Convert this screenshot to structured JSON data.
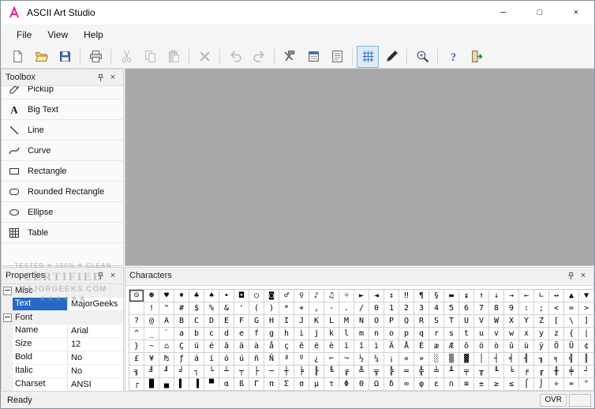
{
  "window": {
    "title": "ASCII Art Studio",
    "controls": {
      "minimize": "─",
      "maximize": "□",
      "close": "×"
    }
  },
  "menu": {
    "items": [
      "File",
      "View",
      "Help"
    ]
  },
  "toolbar": {
    "buttons": [
      {
        "name": "new-button",
        "icon": "new-document-icon"
      },
      {
        "name": "open-button",
        "icon": "open-folder-icon"
      },
      {
        "name": "save-button",
        "icon": "save-icon"
      },
      {
        "separator": true
      },
      {
        "name": "print-button",
        "icon": "print-icon"
      },
      {
        "separator": true
      },
      {
        "name": "cut-button",
        "icon": "cut-icon",
        "disabled": true
      },
      {
        "name": "copy-button",
        "icon": "copy-icon",
        "disabled": true
      },
      {
        "name": "paste-button",
        "icon": "paste-icon",
        "disabled": true
      },
      {
        "separator": true
      },
      {
        "name": "delete-button",
        "icon": "delete-icon",
        "disabled": true
      },
      {
        "separator": true
      },
      {
        "name": "undo-button",
        "icon": "undo-icon",
        "disabled": true
      },
      {
        "name": "redo-button",
        "icon": "redo-icon",
        "disabled": true
      },
      {
        "separator": true
      },
      {
        "name": "tools-button",
        "icon": "tools-icon"
      },
      {
        "name": "properties-button",
        "icon": "property-sheet-icon"
      },
      {
        "name": "text-document-button",
        "icon": "text-document-icon"
      },
      {
        "separator": true
      },
      {
        "name": "grid-toggle-button",
        "icon": "grid-icon",
        "pressed": true
      },
      {
        "name": "pen-button",
        "icon": "pen-icon"
      },
      {
        "separator": true
      },
      {
        "name": "zoom-button",
        "icon": "zoom-icon"
      },
      {
        "separator": true
      },
      {
        "name": "help-button",
        "icon": "help-icon"
      },
      {
        "name": "exit-button",
        "icon": "exit-icon"
      }
    ]
  },
  "toolbox": {
    "title": "Toolbox",
    "items": [
      {
        "label": "Pickup",
        "icon": "pickup-icon"
      },
      {
        "label": "Big Text",
        "icon": "big-text-icon"
      },
      {
        "label": "Line",
        "icon": "line-icon"
      },
      {
        "label": "Curve",
        "icon": "curve-icon"
      },
      {
        "label": "Rectangle",
        "icon": "rectangle-icon"
      },
      {
        "label": "Rounded Rectangle",
        "icon": "rounded-rectangle-icon"
      },
      {
        "label": "Ellipse",
        "icon": "ellipse-icon"
      },
      {
        "label": "Table",
        "icon": "table-icon"
      }
    ]
  },
  "watermark": {
    "line1": "TESTED ✶ 100% ✶ CLEAN",
    "line2": "CERTIFIED",
    "line3": "MAJORGEEKS.COM",
    "line4": "★★★★★★"
  },
  "properties": {
    "title": "Properties",
    "groups": [
      {
        "label": "Misc",
        "rows": [
          {
            "name": "Text",
            "value": "MajorGeeks",
            "selected": true
          }
        ]
      },
      {
        "label": "Font",
        "rows": [
          {
            "name": "Name",
            "value": "Arial"
          },
          {
            "name": "Size",
            "value": "12"
          },
          {
            "name": "Bold",
            "value": "No"
          },
          {
            "name": "Italic",
            "value": "No"
          },
          {
            "name": "Charset",
            "value": "ANSI"
          }
        ]
      }
    ]
  },
  "characters": {
    "title": "Characters",
    "selected": {
      "row": 0,
      "col": 0
    },
    "rows": [
      [
        "☺",
        "☻",
        "♥",
        "♦",
        "♣",
        "♠",
        "•",
        "◘",
        "○",
        "◙",
        "♂",
        "♀",
        "♪",
        "♫",
        "☼",
        "►",
        "◄",
        "↕",
        "‼",
        "¶",
        "§",
        "▬",
        "↨",
        "↑",
        "↓",
        "→",
        "←",
        "∟",
        "↔",
        "▲",
        "▼"
      ],
      [
        " ",
        "!",
        "\"",
        "#",
        "$",
        "%",
        "&",
        "'",
        "(",
        ")",
        "*",
        "+",
        ",",
        "-",
        ".",
        "/",
        "0",
        "1",
        "2",
        "3",
        "4",
        "5",
        "6",
        "7",
        "8",
        "9",
        ":",
        ";",
        "<",
        "=",
        ">"
      ],
      [
        "?",
        "@",
        "A",
        "B",
        "C",
        "D",
        "E",
        "F",
        "G",
        "H",
        "I",
        "J",
        "K",
        "L",
        "M",
        "N",
        "O",
        "P",
        "Q",
        "R",
        "S",
        "T",
        "U",
        "V",
        "W",
        "X",
        "Y",
        "Z",
        "[",
        "\\",
        "]"
      ],
      [
        "^",
        "_",
        "`",
        "a",
        "b",
        "c",
        "d",
        "e",
        "f",
        "g",
        "h",
        "i",
        "j",
        "k",
        "l",
        "m",
        "n",
        "o",
        "p",
        "q",
        "r",
        "s",
        "t",
        "u",
        "v",
        "w",
        "x",
        "y",
        "z",
        "{",
        "|"
      ],
      [
        "}",
        "~",
        "⌂",
        "Ç",
        "ü",
        "é",
        "â",
        "ä",
        "à",
        "å",
        "ç",
        "ê",
        "ë",
        "è",
        "ï",
        "î",
        "ì",
        "Ä",
        "Å",
        "É",
        "æ",
        "Æ",
        "ô",
        "ö",
        "ò",
        "û",
        "ù",
        "ÿ",
        "Ö",
        "Ü",
        "¢"
      ],
      [
        "£",
        "¥",
        "₧",
        "ƒ",
        "á",
        "í",
        "ó",
        "ú",
        "ñ",
        "Ñ",
        "ª",
        "º",
        "¿",
        "⌐",
        "¬",
        "½",
        "¼",
        "¡",
        "«",
        "»",
        "░",
        "▒",
        "▓",
        "│",
        "┤",
        "╡",
        "╢",
        "╖",
        "╕",
        "╣",
        "║"
      ],
      [
        "╗",
        "╝",
        "╜",
        "╛",
        "┐",
        "└",
        "┴",
        "┬",
        "├",
        "─",
        "┼",
        "╞",
        "╟",
        "╚",
        "╔",
        "╩",
        "╦",
        "╠",
        "═",
        "╬",
        "╧",
        "╨",
        "╤",
        "╥",
        "╙",
        "╘",
        "╒",
        "╓",
        "╫",
        "╪",
        "┘"
      ],
      [
        "┌",
        "█",
        "▄",
        "▌",
        "▐",
        "▀",
        "α",
        "ß",
        "Γ",
        "π",
        "Σ",
        "σ",
        "µ",
        "τ",
        "Φ",
        "Θ",
        "Ω",
        "δ",
        "∞",
        "φ",
        "ε",
        "∩",
        "≡",
        "±",
        "≥",
        "≤",
        "⌠",
        "⌡",
        "÷",
        "≈",
        "°"
      ]
    ]
  },
  "statusbar": {
    "ready": "Ready",
    "ovr": "OVR"
  },
  "colors": {
    "selection_blue": "#2668c5",
    "canvas_gray": "#a8a8a8",
    "pressed_button_bg": "#dcebf9",
    "app_logo_magenta": "#e0218a"
  }
}
